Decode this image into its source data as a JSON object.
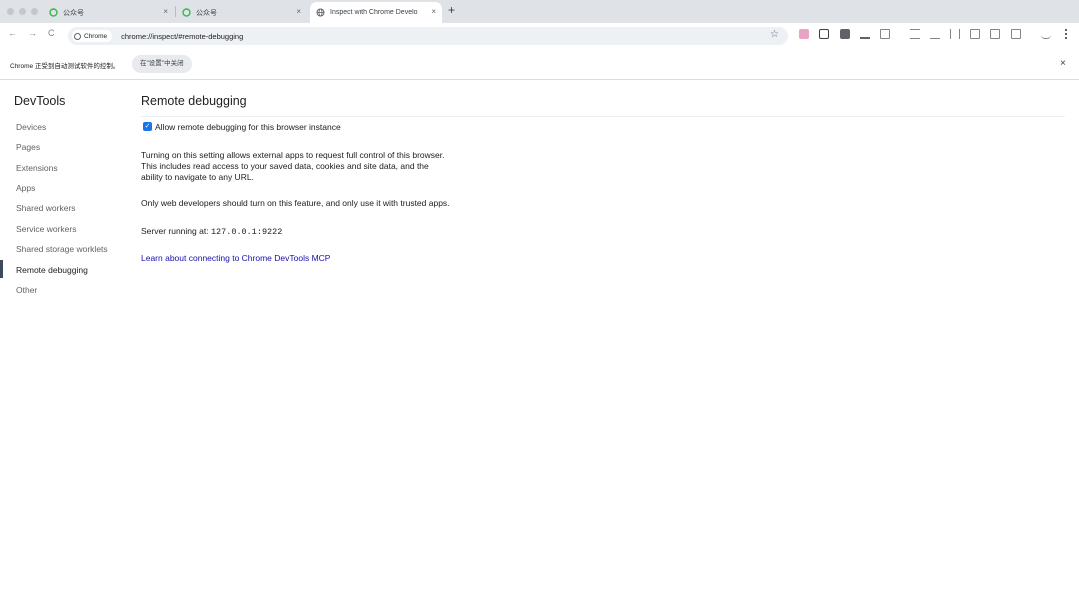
{
  "tabs": [
    {
      "title": "公众号",
      "close": "×"
    },
    {
      "title": "公众号",
      "close": "×"
    },
    {
      "title": "Inspect with Chrome Develo",
      "close": "×"
    }
  ],
  "new_tab": "+",
  "nav": {
    "back": "←",
    "forward": "→",
    "reload": "C"
  },
  "omnibox": {
    "chip_label": "Chrome",
    "url": "chrome://inspect/#remote-debugging",
    "star": "☆"
  },
  "infobar": {
    "text": "Chrome 正受到自动测试软件的控制。",
    "button_label": "在\"设置\"中关闭",
    "close": "×"
  },
  "sidebar": {
    "title": "DevTools",
    "items": [
      {
        "label": "Devices"
      },
      {
        "label": "Pages"
      },
      {
        "label": "Extensions"
      },
      {
        "label": "Apps"
      },
      {
        "label": "Shared workers"
      },
      {
        "label": "Service workers"
      },
      {
        "label": "Shared storage worklets"
      },
      {
        "label": "Remote debugging"
      },
      {
        "label": "Other"
      }
    ],
    "active_item": "Remote debugging"
  },
  "main": {
    "title": "Remote debugging",
    "checkbox_checked": true,
    "checkbox_label": "Allow remote debugging for this browser instance",
    "description_lines": [
      "Turning on this setting allows external apps to request full control of this browser.",
      "This includes read access to your saved data, cookies and site data, and the",
      "ability to navigate to any URL."
    ],
    "warning": "Only web developers should turn on this feature, and only use it with trusted apps.",
    "server_label": "Server running at:",
    "server_address": "127.0.0.1:9222",
    "link_text": "Learn about connecting to Chrome DevTools MCP"
  },
  "colors": {
    "accent": "#1a73e8",
    "link": "#1a0dab",
    "tabstrip": "#dfe3e8"
  }
}
